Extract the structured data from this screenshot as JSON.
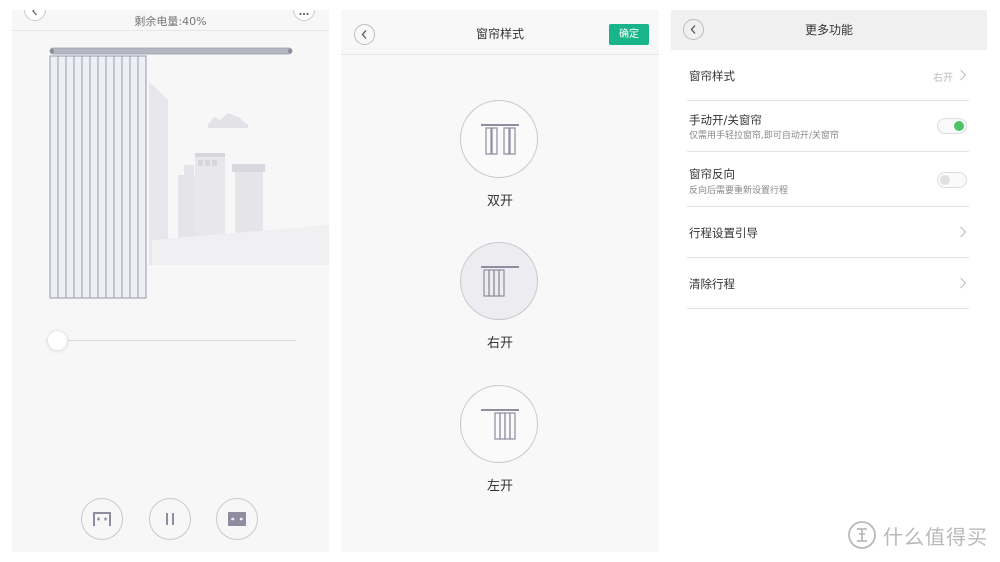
{
  "colors": {
    "accent": "#18b48a",
    "toggle_on": "#4cc36b",
    "curtain_fill": "#eeeef5",
    "curtain_stroke": "#9a9aab",
    "rail": "#b6b6c3",
    "building": "#e4e4e9"
  },
  "curtain_control": {
    "battery_text": "剩余电量:40%",
    "slider_value_fraction": 0.0,
    "icons": {
      "back": "chevron-left-icon",
      "more": "more-dots-icon",
      "open_all": "curtain-open-icon",
      "pause": "pause-icon",
      "close_all": "curtain-close-icon"
    }
  },
  "style_screen": {
    "title": "窗帘样式",
    "confirm_label": "确定",
    "options": [
      {
        "label": "双开",
        "selected": false,
        "icon": "curtain-double-open-icon"
      },
      {
        "label": "右开",
        "selected": true,
        "icon": "curtain-right-open-icon"
      },
      {
        "label": "左开",
        "selected": false,
        "icon": "curtain-left-open-icon"
      }
    ]
  },
  "more_screen": {
    "title": "更多功能",
    "rows": [
      {
        "title": "窗帘样式",
        "value": "右开",
        "control": "chevron"
      },
      {
        "title": "手动开/关窗帘",
        "subtitle": "仅需用手轻拉窗帘,即可自动开/关窗帘",
        "control": "toggle",
        "on": true
      },
      {
        "title": "窗帘反向",
        "subtitle": "反向后需要重新设置行程",
        "control": "toggle",
        "on": false
      },
      {
        "title": "行程设置引导",
        "control": "chevron"
      },
      {
        "title": "清除行程",
        "control": "chevron"
      }
    ]
  },
  "watermark": {
    "logo": "zhi-badge-logo",
    "text": "什么值得买"
  }
}
